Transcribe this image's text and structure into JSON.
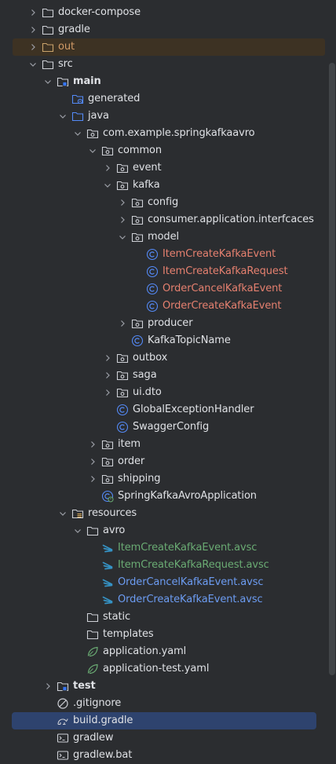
{
  "project_tree": {
    "rows": [
      {
        "label": "docker-compose",
        "depth": 1,
        "arrow": "right",
        "icon": "folder-icon",
        "color": "default"
      },
      {
        "label": "gradle",
        "depth": 1,
        "arrow": "right",
        "icon": "folder-icon",
        "color": "default"
      },
      {
        "label": "out",
        "depth": 1,
        "arrow": "right",
        "icon": "folder-excluded-icon",
        "color": "out",
        "state": "excluded"
      },
      {
        "label": "src",
        "depth": 1,
        "arrow": "down",
        "icon": "folder-icon",
        "color": "default"
      },
      {
        "label": "main",
        "depth": 2,
        "arrow": "down",
        "icon": "module-folder-icon",
        "color": "default",
        "bold": true
      },
      {
        "label": "generated",
        "depth": 3,
        "arrow": "none",
        "icon": "generated-sources-folder-icon",
        "color": "default"
      },
      {
        "label": "java",
        "depth": 3,
        "arrow": "down",
        "icon": "source-folder-icon",
        "color": "default"
      },
      {
        "label": "com.example.springkafkaavro",
        "depth": 4,
        "arrow": "down",
        "icon": "package-icon",
        "color": "default"
      },
      {
        "label": "common",
        "depth": 5,
        "arrow": "down",
        "icon": "package-icon",
        "color": "default"
      },
      {
        "label": "event",
        "depth": 6,
        "arrow": "right",
        "icon": "package-icon",
        "color": "default"
      },
      {
        "label": "kafka",
        "depth": 6,
        "arrow": "down",
        "icon": "package-icon",
        "color": "default"
      },
      {
        "label": "config",
        "depth": 7,
        "arrow": "right",
        "icon": "package-icon",
        "color": "default"
      },
      {
        "label": "consumer.application.interfcaces",
        "depth": 7,
        "arrow": "right",
        "icon": "package-icon",
        "color": "default"
      },
      {
        "label": "model",
        "depth": 7,
        "arrow": "down",
        "icon": "package-icon",
        "color": "default"
      },
      {
        "label": "ItemCreateKafkaEvent",
        "depth": 8,
        "arrow": "none",
        "icon": "java-class-icon",
        "color": "red"
      },
      {
        "label": "ItemCreateKafkaRequest",
        "depth": 8,
        "arrow": "none",
        "icon": "java-class-icon",
        "color": "red"
      },
      {
        "label": "OrderCancelKafkaEvent",
        "depth": 8,
        "arrow": "none",
        "icon": "java-class-icon",
        "color": "red"
      },
      {
        "label": "OrderCreateKafkaEvent",
        "depth": 8,
        "arrow": "none",
        "icon": "java-class-icon",
        "color": "red"
      },
      {
        "label": "producer",
        "depth": 7,
        "arrow": "right",
        "icon": "package-icon",
        "color": "default"
      },
      {
        "label": "KafkaTopicName",
        "depth": 7,
        "arrow": "none",
        "icon": "java-class-icon",
        "color": "default"
      },
      {
        "label": "outbox",
        "depth": 6,
        "arrow": "right",
        "icon": "package-icon",
        "color": "default"
      },
      {
        "label": "saga",
        "depth": 6,
        "arrow": "right",
        "icon": "package-icon",
        "color": "default"
      },
      {
        "label": "ui.dto",
        "depth": 6,
        "arrow": "right",
        "icon": "package-icon",
        "color": "default"
      },
      {
        "label": "GlobalExceptionHandler",
        "depth": 6,
        "arrow": "none",
        "icon": "java-class-icon",
        "color": "default"
      },
      {
        "label": "SwaggerConfig",
        "depth": 6,
        "arrow": "none",
        "icon": "java-class-icon",
        "color": "default"
      },
      {
        "label": "item",
        "depth": 5,
        "arrow": "right",
        "icon": "package-icon",
        "color": "default"
      },
      {
        "label": "order",
        "depth": 5,
        "arrow": "right",
        "icon": "package-icon",
        "color": "default"
      },
      {
        "label": "shipping",
        "depth": 5,
        "arrow": "right",
        "icon": "package-icon",
        "color": "default"
      },
      {
        "label": "SpringKafkaAvroApplication",
        "depth": 5,
        "arrow": "none",
        "icon": "spring-boot-application-icon",
        "color": "default"
      },
      {
        "label": "resources",
        "depth": 3,
        "arrow": "down",
        "icon": "resources-folder-icon",
        "color": "default"
      },
      {
        "label": "avro",
        "depth": 4,
        "arrow": "down",
        "icon": "folder-icon",
        "color": "default"
      },
      {
        "label": "ItemCreateKafkaEvent.avsc",
        "depth": 5,
        "arrow": "none",
        "icon": "avro-file-icon",
        "color": "green"
      },
      {
        "label": "ItemCreateKafkaRequest.avsc",
        "depth": 5,
        "arrow": "none",
        "icon": "avro-file-icon",
        "color": "green"
      },
      {
        "label": "OrderCancelKafkaEvent.avsc",
        "depth": 5,
        "arrow": "none",
        "icon": "avro-file-icon",
        "color": "blue"
      },
      {
        "label": "OrderCreateKafkaEvent.avsc",
        "depth": 5,
        "arrow": "none",
        "icon": "avro-file-icon",
        "color": "blue"
      },
      {
        "label": "static",
        "depth": 4,
        "arrow": "none",
        "icon": "folder-icon",
        "color": "default"
      },
      {
        "label": "templates",
        "depth": 4,
        "arrow": "none",
        "icon": "folder-icon",
        "color": "default"
      },
      {
        "label": "application.yaml",
        "depth": 4,
        "arrow": "none",
        "icon": "spring-yaml-icon",
        "color": "default"
      },
      {
        "label": "application-test.yaml",
        "depth": 4,
        "arrow": "none",
        "icon": "spring-yaml-icon",
        "color": "default"
      },
      {
        "label": "test",
        "depth": 2,
        "arrow": "right",
        "icon": "module-folder-icon",
        "color": "default",
        "bold": true
      },
      {
        "label": ".gitignore",
        "depth": 2,
        "arrow": "none",
        "icon": "gitignore-icon",
        "color": "default"
      },
      {
        "label": "build.gradle",
        "depth": 2,
        "arrow": "none",
        "icon": "gradle-elephant-icon",
        "color": "default",
        "state": "selected"
      },
      {
        "label": "gradlew",
        "depth": 2,
        "arrow": "none",
        "icon": "terminal-file-icon",
        "color": "default"
      },
      {
        "label": "gradlew.bat",
        "depth": 2,
        "arrow": "none",
        "icon": "terminal-file-icon",
        "color": "default"
      }
    ]
  },
  "colors": {
    "background": "#2b2d30",
    "text_default": "#dfe1e5",
    "text_excluded": "#d19a66",
    "text_modified_red": "#e5806f",
    "text_added_green": "#6aab73",
    "text_changed_blue": "#6c9cf2",
    "excluded_row_bg": "#3d3223",
    "selected_row_bg": "#2e436e",
    "class_icon": "#548af7"
  }
}
